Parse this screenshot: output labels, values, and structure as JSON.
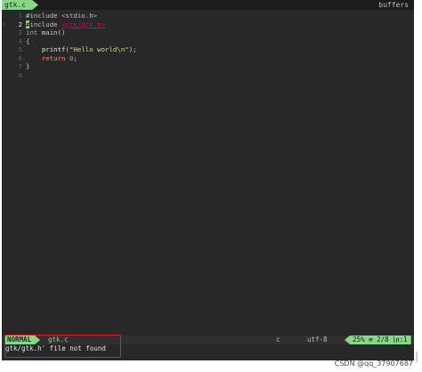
{
  "tabline": {
    "active_tab": "gtk.c",
    "buffers_label": "buffers"
  },
  "editor": {
    "lines": [
      {
        "num": "1",
        "sign": "",
        "tokens": [
          {
            "cls": "pp",
            "text": "#include <stdio.h>"
          }
        ]
      },
      {
        "num": "2",
        "sign": "✗",
        "current": true,
        "tokens": [
          {
            "cls": "cursor",
            "text": "#"
          },
          {
            "cls": "pp",
            "text": "include "
          },
          {
            "cls": "err",
            "text": "<gtk/gtk.h>"
          }
        ]
      },
      {
        "num": "3",
        "sign": "",
        "tokens": [
          {
            "cls": "kw",
            "text": "int"
          },
          {
            "cls": "",
            "text": " main()"
          }
        ]
      },
      {
        "num": "4",
        "sign": "",
        "tokens": [
          {
            "cls": "",
            "text": "{"
          }
        ]
      },
      {
        "num": "5",
        "sign": "",
        "tokens": [
          {
            "cls": "",
            "text": "    "
          },
          {
            "cls": "fn",
            "text": "printf"
          },
          {
            "cls": "",
            "text": "("
          },
          {
            "cls": "str",
            "text": "\"Hello world\\n\""
          },
          {
            "cls": "",
            "text": ");"
          }
        ]
      },
      {
        "num": "6",
        "sign": "",
        "tokens": [
          {
            "cls": "",
            "text": "    "
          },
          {
            "cls": "ret",
            "text": "return"
          },
          {
            "cls": "",
            "text": " "
          },
          {
            "cls": "num",
            "text": "0"
          },
          {
            "cls": "",
            "text": ";"
          }
        ]
      },
      {
        "num": "7",
        "sign": "",
        "tokens": [
          {
            "cls": "",
            "text": "}"
          }
        ]
      },
      {
        "num": "8",
        "sign": "",
        "tokens": []
      }
    ]
  },
  "statusline": {
    "mode": "NORMAL",
    "filename": "gtk.c",
    "filetype": "c",
    "encoding": "utf-8",
    "position": "25% ≡ 2/8 ㏑:1",
    "warn_segment": "⚠"
  },
  "cmdline": {
    "message": "gtk/gtk.h' file not found"
  },
  "watermark": {
    "text": "CSDN @qq_37907687"
  },
  "colors": {
    "background": "#282828",
    "accent_green": "#87d787",
    "error_red": "#d7005f",
    "highlight_box": "#e0202a"
  }
}
